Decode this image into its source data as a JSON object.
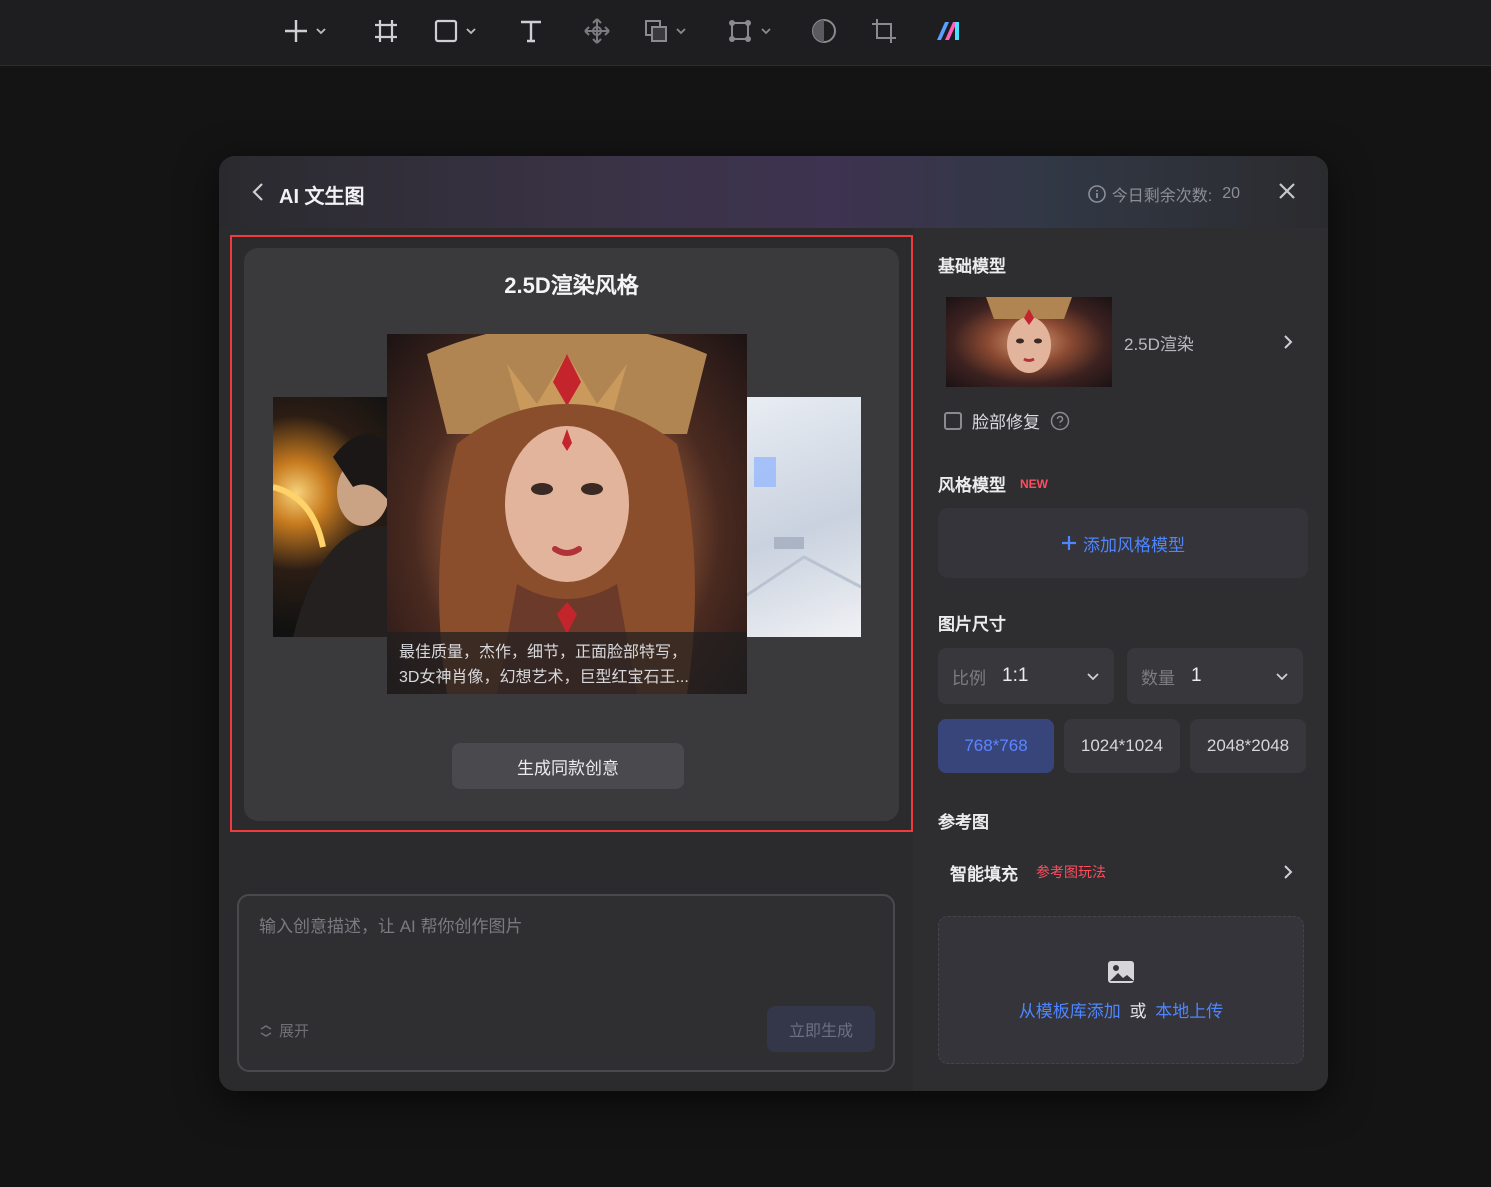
{
  "dialog": {
    "title": "AI 文生图",
    "quota_label": "今日剩余次数:",
    "quota_value": "20"
  },
  "preview": {
    "title": "2.5D渲染风格",
    "caption_line1": "最佳质量，杰作，细节，正面脸部特写，",
    "caption_line2": "3D女神肖像，幻想艺术，巨型红宝石王...",
    "generate_same_label": "生成同款创意"
  },
  "prompt": {
    "placeholder": "输入创意描述，让 AI 帮你创作图片",
    "expand_label": "展开",
    "generate_label": "立即生成"
  },
  "settings": {
    "base_model_title": "基础模型",
    "base_model_name": "2.5D渲染",
    "face_fix_label": "脸部修复",
    "style_model_title": "风格模型",
    "style_model_badge": "NEW",
    "add_style_label": "添加风格模型",
    "size_title": "图片尺寸",
    "ratio_label": "比例",
    "ratio_value": "1:1",
    "count_label": "数量",
    "count_value": "1",
    "sizes": [
      "768*768",
      "1024*1024",
      "2048*2048"
    ],
    "reference_title": "参考图",
    "smart_fill_label": "智能填充",
    "smart_fill_tag": "参考图玩法",
    "upload_from_template": "从模板库添加",
    "upload_or": "或",
    "upload_local": "本地上传"
  },
  "colors": {
    "accent": "#4d86ff",
    "highlight_border": "#ef3b3b",
    "badge": "#ff4d5e"
  }
}
